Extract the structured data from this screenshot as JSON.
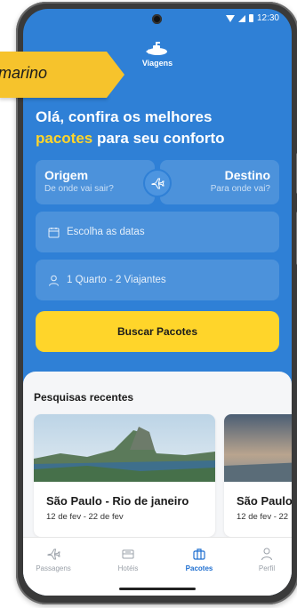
{
  "brand": {
    "name": "Viagens",
    "banner": "marino"
  },
  "status_bar": {
    "time": "12:30"
  },
  "hero": {
    "line1": "Olá, confira os melhores",
    "highlight": "pacotes",
    "line2_rest": " para seu conforto"
  },
  "search": {
    "origin_label": "Origem",
    "origin_hint": "De onde vai sair?",
    "destination_label": "Destino",
    "destination_hint": "Para onde vai?",
    "dates_placeholder": "Escolha as datas",
    "guests_value": "1 Quarto - 2 Viajantes",
    "submit_label": "Buscar Pacotes"
  },
  "recent": {
    "title": "Pesquisas recentes",
    "items": [
      {
        "title": "São Paulo - Rio de janeiro",
        "dates": "12 de fev - 22 de fev"
      },
      {
        "title": "São Paulo",
        "dates": "12 de fev - 22"
      }
    ]
  },
  "tabs": [
    {
      "label": "Passagens",
      "icon": "plane-icon"
    },
    {
      "label": "Hotéis",
      "icon": "hotel-icon"
    },
    {
      "label": "Pacotes",
      "icon": "suitcase-icon",
      "active": true
    },
    {
      "label": "Perfil",
      "icon": "user-icon"
    }
  ],
  "colors": {
    "primary": "#2f80d6",
    "accent": "#ffd52a",
    "active_tab": "#1f6fd0"
  }
}
